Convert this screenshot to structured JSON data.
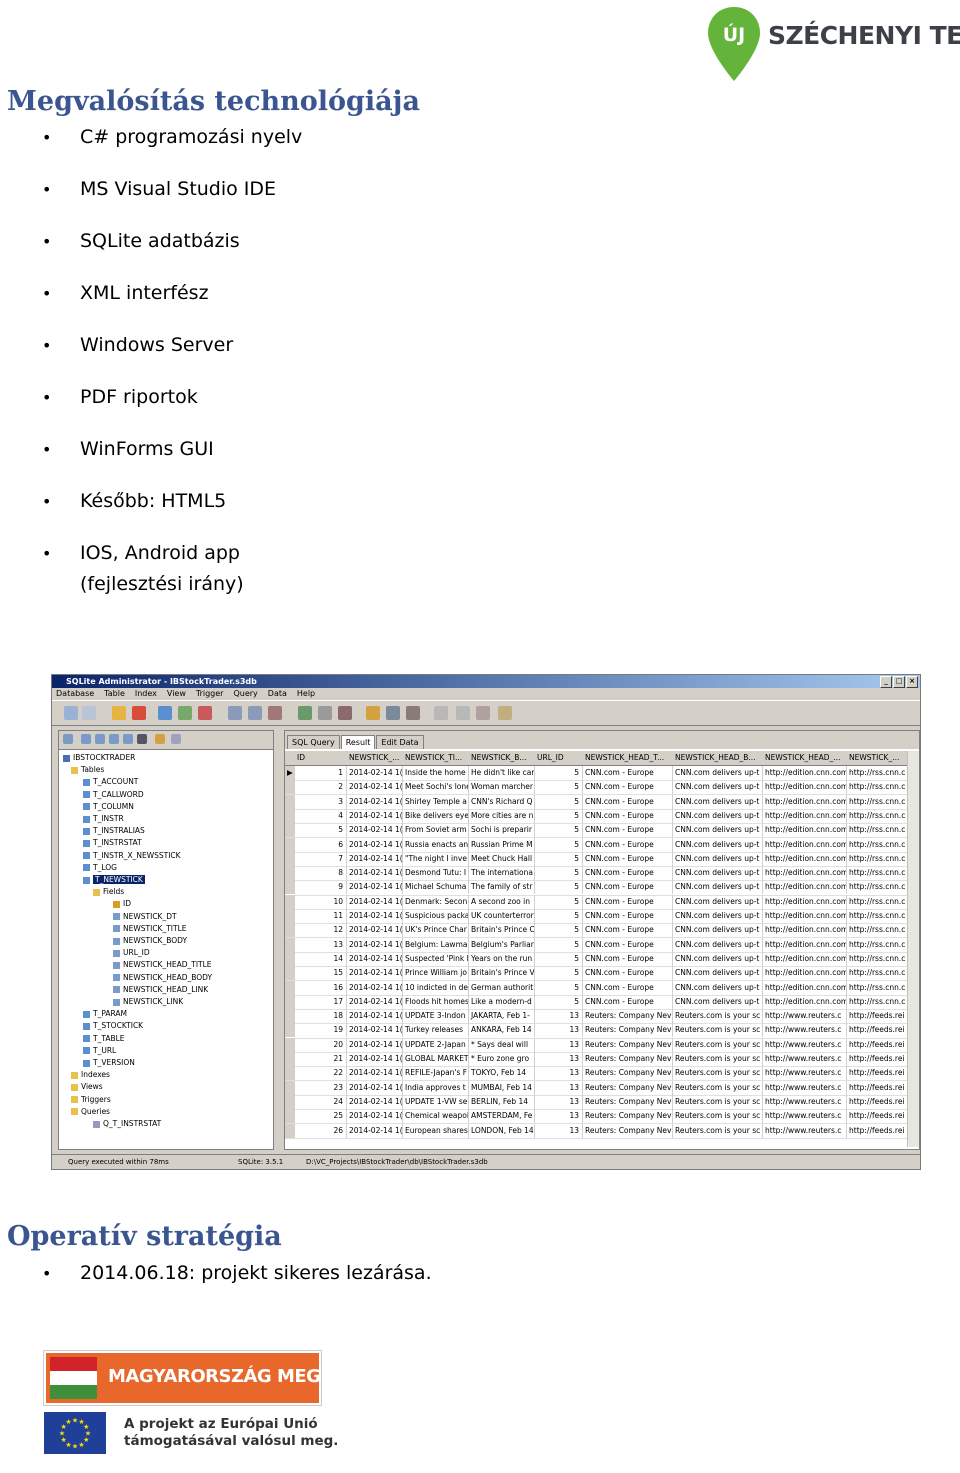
{
  "logo_top": {
    "text": "SZÉCHENYI TERV",
    "badge": "ÚJ",
    "color_green": "#64b33a",
    "color_text": "#3c4149"
  },
  "section1": {
    "title": "Megvalósítás technológiája",
    "items": [
      "C# programozási nyelv",
      "MS Visual Studio IDE",
      "SQLite adatbázis",
      "XML interfész",
      "Windows Server",
      "PDF riportok",
      "WinForms GUI",
      "Később: HTML5",
      "IOS, Android app",
      "(fejlesztési irány)"
    ]
  },
  "app": {
    "title": "SQLite Administrator - IBStockTrader.s3db",
    "menu": [
      "Database",
      "Table",
      "Index",
      "View",
      "Trigger",
      "Query",
      "Data",
      "Help"
    ],
    "tree": {
      "root": "IBSTOCKTRADER",
      "tables_label": "Tables",
      "tables_before": [
        "T_ACCOUNT",
        "T_CALLWORD",
        "T_COLUMN",
        "T_INSTR",
        "T_INSTRALIAS",
        "T_INSTRSTAT",
        "T_INSTR_X_NEWSSTICK",
        "T_LOG"
      ],
      "selected": "T_NEWSTICK",
      "fields_label": "Fields",
      "fields": [
        "ID",
        "NEWSTICK_DT",
        "NEWSTICK_TITLE",
        "NEWSTICK_BODY",
        "URL_ID",
        "NEWSTICK_HEAD_TITLE",
        "NEWSTICK_HEAD_BODY",
        "NEWSTICK_HEAD_LINK",
        "NEWSTICK_LINK"
      ],
      "tables_after": [
        "T_PARAM",
        "T_STOCKTICK",
        "T_TABLE",
        "T_URL",
        "T_VERSION"
      ],
      "indexes_label": "Indexes",
      "views_label": "Views",
      "triggers_label": "Triggers",
      "queries_label": "Queries",
      "query": "Q_T_INSTRSTAT"
    },
    "tabs": [
      "SQL Query",
      "Result",
      "Edit Data"
    ],
    "columns": [
      "ID",
      "NEWSTICK_...",
      "NEWSTICK_TI...",
      "NEWSTICK_B...",
      "URL_ID",
      "NEWSTICK_HEAD_T...",
      "NEWSTICK_HEAD_B...",
      "NEWSTICK_HEAD_...",
      "NEWSTICK_..."
    ],
    "rows": [
      [
        "1",
        "2014-02-14 1(",
        "Inside the home",
        "He didn't like car",
        "5",
        "CNN.com - Europe",
        "CNN.com delivers up-t",
        "http://edition.cnn.com",
        "http://rss.cnn.c"
      ],
      [
        "2",
        "2014-02-14 1(",
        "Meet Sochi's lone",
        "Woman marcher",
        "5",
        "CNN.com - Europe",
        "CNN.com delivers up-t",
        "http://edition.cnn.com",
        "http://rss.cnn.c"
      ],
      [
        "3",
        "2014-02-14 1(",
        "Shirley Temple a",
        "CNN's Richard Q",
        "5",
        "CNN.com - Europe",
        "CNN.com delivers up-t",
        "http://edition.cnn.com",
        "http://rss.cnn.c"
      ],
      [
        "4",
        "2014-02-14 1(",
        "Bike delivers eye",
        "More cities are n",
        "5",
        "CNN.com - Europe",
        "CNN.com delivers up-t",
        "http://edition.cnn.com",
        "http://rss.cnn.c"
      ],
      [
        "5",
        "2014-02-14 1(",
        "From Soviet arm",
        "Sochi is preparir",
        "5",
        "CNN.com - Europe",
        "CNN.com delivers up-t",
        "http://edition.cnn.com",
        "http://rss.cnn.c"
      ],
      [
        "6",
        "2014-02-14 1(",
        "Russia enacts an",
        "Russian Prime M",
        "5",
        "CNN.com - Europe",
        "CNN.com delivers up-t",
        "http://edition.cnn.com",
        "http://rss.cnn.c"
      ],
      [
        "7",
        "2014-02-14 1(",
        "\"The night I inve",
        "Meet Chuck Hall",
        "5",
        "CNN.com - Europe",
        "CNN.com delivers up-t",
        "http://edition.cnn.com",
        "http://rss.cnn.c"
      ],
      [
        "8",
        "2014-02-14 1(",
        "Desmond Tutu: I",
        "The internationa",
        "5",
        "CNN.com - Europe",
        "CNN.com delivers up-t",
        "http://edition.cnn.com",
        "http://rss.cnn.c"
      ],
      [
        "9",
        "2014-02-14 1(",
        "Michael Schuma",
        "The family of str",
        "5",
        "CNN.com - Europe",
        "CNN.com delivers up-t",
        "http://edition.cnn.com",
        "http://rss.cnn.c"
      ],
      [
        "10",
        "2014-02-14 1(",
        "Denmark: Secon",
        "A second zoo in",
        "5",
        "CNN.com - Europe",
        "CNN.com delivers up-t",
        "http://edition.cnn.com",
        "http://rss.cnn.c"
      ],
      [
        "11",
        "2014-02-14 1(",
        "Suspicious packa",
        "UK counterterror",
        "5",
        "CNN.com - Europe",
        "CNN.com delivers up-t",
        "http://edition.cnn.com",
        "http://rss.cnn.c"
      ],
      [
        "12",
        "2014-02-14 1(",
        "UK's Prince Char",
        "Britain's Prince C",
        "5",
        "CNN.com - Europe",
        "CNN.com delivers up-t",
        "http://edition.cnn.com",
        "http://rss.cnn.c"
      ],
      [
        "13",
        "2014-02-14 1(",
        "Belgium: Lawma",
        "Belgium's Parliar",
        "5",
        "CNN.com - Europe",
        "CNN.com delivers up-t",
        "http://edition.cnn.com",
        "http://rss.cnn.c"
      ],
      [
        "14",
        "2014-02-14 1(",
        "Suspected 'Pink F",
        "Years on the run",
        "5",
        "CNN.com - Europe",
        "CNN.com delivers up-t",
        "http://edition.cnn.com",
        "http://rss.cnn.c"
      ],
      [
        "15",
        "2014-02-14 1(",
        "Prince William jo",
        "Britain's Prince V",
        "5",
        "CNN.com - Europe",
        "CNN.com delivers up-t",
        "http://edition.cnn.com",
        "http://rss.cnn.c"
      ],
      [
        "16",
        "2014-02-14 1(",
        "10 indicted in de",
        "German authorit",
        "5",
        "CNN.com - Europe",
        "CNN.com delivers up-t",
        "http://edition.cnn.com",
        "http://rss.cnn.c"
      ],
      [
        "17",
        "2014-02-14 1(",
        "Floods hit homes",
        "Like a modern-d",
        "5",
        "CNN.com - Europe",
        "CNN.com delivers up-t",
        "http://edition.cnn.com",
        "http://rss.cnn.c"
      ],
      [
        "18",
        "2014-02-14 1(",
        "UPDATE 3-Indon",
        "JAKARTA, Feb 1-",
        "13",
        "Reuters: Company Nev",
        "Reuters.com is your sc",
        "http://www.reuters.c",
        "http://feeds.rei"
      ],
      [
        "19",
        "2014-02-14 1(",
        "Turkey releases",
        "ANKARA, Feb 14",
        "13",
        "Reuters: Company Nev",
        "Reuters.com is your sc",
        "http://www.reuters.c",
        "http://feeds.rei"
      ],
      [
        "20",
        "2014-02-14 1(",
        "UPDATE 2-Japan",
        "* Says deal will",
        "13",
        "Reuters: Company Nev",
        "Reuters.com is your sc",
        "http://www.reuters.c",
        "http://feeds.rei"
      ],
      [
        "21",
        "2014-02-14 1(",
        "GLOBAL MARKET",
        "* Euro zone gro",
        "13",
        "Reuters: Company Nev",
        "Reuters.com is your sc",
        "http://www.reuters.c",
        "http://feeds.rei"
      ],
      [
        "22",
        "2014-02-14 1(",
        "REFILE-Japan's F",
        "TOKYO, Feb 14",
        "13",
        "Reuters: Company Nev",
        "Reuters.com is your sc",
        "http://www.reuters.c",
        "http://feeds.rei"
      ],
      [
        "23",
        "2014-02-14 1(",
        "India approves t",
        "MUMBAI, Feb 14",
        "13",
        "Reuters: Company Nev",
        "Reuters.com is your sc",
        "http://www.reuters.c",
        "http://feeds.rei"
      ],
      [
        "24",
        "2014-02-14 1(",
        "UPDATE 1-VW se",
        "BERLIN, Feb 14",
        "13",
        "Reuters: Company Nev",
        "Reuters.com is your sc",
        "http://www.reuters.c",
        "http://feeds.rei"
      ],
      [
        "25",
        "2014-02-14 1(",
        "Chemical weapoi",
        "AMSTERDAM, Fe",
        "13",
        "Reuters: Company Nev",
        "Reuters.com is your sc",
        "http://www.reuters.c",
        "http://feeds.rei"
      ],
      [
        "26",
        "2014-02-14 1(",
        "European shares",
        "LONDON, Feb 14",
        "13",
        "Reuters: Company Nev",
        "Reuters.com is your sc",
        "http://www.reuters.c",
        "http://feeds.rei"
      ]
    ],
    "status": {
      "query": "Query executed within 78ms",
      "version": "SQLite: 3.5.1",
      "path": "D:\\VC_Projects\\IBStockTrader\\db\\IBStockTrader.s3db"
    }
  },
  "section2": {
    "title": "Operatív stratégia",
    "items": [
      "2014.06.18: projekt sikeres lezárása."
    ]
  },
  "logo_mm": {
    "text": "MAGYARORSZÁG MEGÚJUL",
    "color": "#e8682c"
  },
  "eu": {
    "text": "A projekt az Európai Unió\ntámogatásával valósul meg."
  }
}
